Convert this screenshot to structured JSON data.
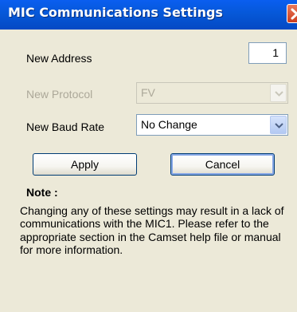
{
  "window": {
    "title": "MIC Communications Settings",
    "close_icon": "close-icon"
  },
  "fields": {
    "address_label": "New Address",
    "address_value": "1",
    "protocol_label": "New Protocol",
    "protocol_value": "FV",
    "baud_label": "New Baud Rate",
    "baud_value": "No Change"
  },
  "buttons": {
    "apply": "Apply",
    "cancel": "Cancel"
  },
  "note": {
    "title": "Note :",
    "text": "Changing any of these settings may result in a lack of communications with the MIC1.  Please refer to the appropriate section in the Camset help file or manual for more information."
  },
  "colors": {
    "titlebar": "#0658d8",
    "window_bg": "#ece9d8",
    "close_button": "#cc3d1d"
  }
}
